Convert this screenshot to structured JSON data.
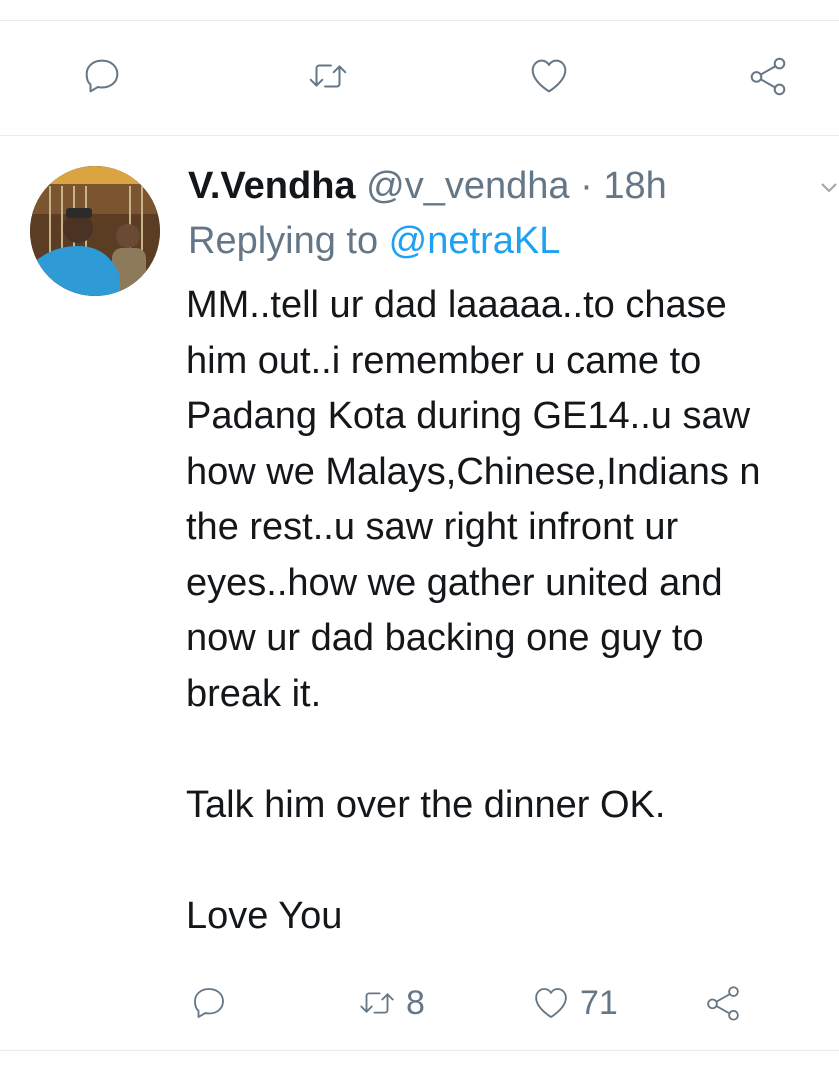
{
  "top_actions": {
    "reply_icon": "reply-icon",
    "retweet_icon": "retweet-icon",
    "like_icon": "heart-icon",
    "share_icon": "share-icon"
  },
  "tweet": {
    "author_name": "V.Vendha",
    "author_handle": "@v_vendha",
    "separator": "·",
    "time": "18h",
    "replying_prefix": "Replying to ",
    "replying_to": "@netraKL",
    "text": "MM..tell ur dad laaaaa..to chase\nhim out..i remember u came to\nPadang Kota during GE14..u saw\nhow we Malays,Chinese,Indians n\nthe rest..u saw right infront ur\neyes..how we gather united and\nnow ur dad backing one guy to\nbreak it.\n\nTalk him over the dinner OK.\n\nLove You",
    "retweet_count": "8",
    "like_count": "71"
  },
  "colors": {
    "text": "#14171a",
    "secondary": "#657786",
    "link": "#1da1f2",
    "divider": "#e6ecf0"
  }
}
